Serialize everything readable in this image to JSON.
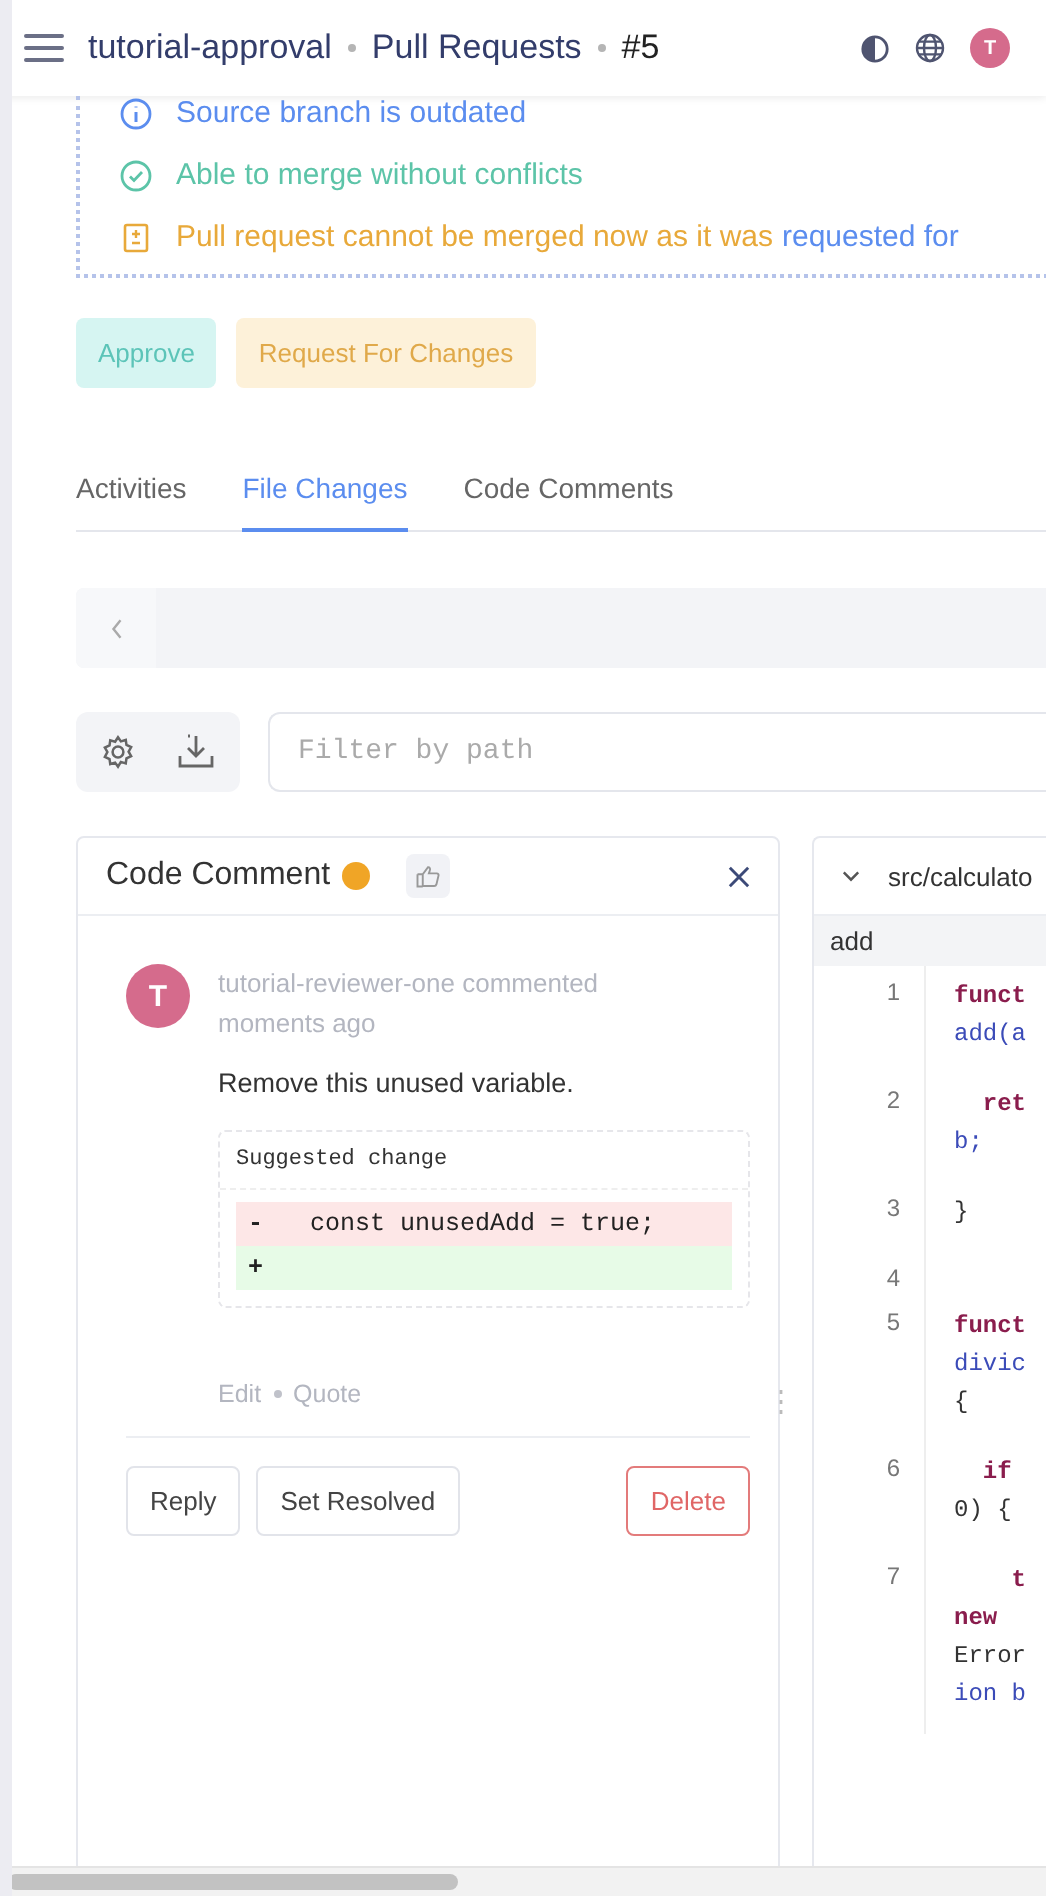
{
  "header": {
    "breadcrumbs": [
      "tutorial-approval",
      "Pull Requests",
      "#5"
    ],
    "avatar_initial": "T"
  },
  "merge_checks": [
    {
      "kind": "info",
      "text": "Source branch is outdated"
    },
    {
      "kind": "success",
      "text": "Able to merge without conflicts"
    },
    {
      "kind": "warning",
      "text": "Pull request cannot be merged now as it was",
      "link": "requested for"
    }
  ],
  "review_buttons": [
    {
      "kind": "approve",
      "label": "Approve"
    },
    {
      "kind": "changes",
      "label": "Request For Changes"
    }
  ],
  "tabs": [
    {
      "label": "Activities",
      "selected": false
    },
    {
      "label": "File Changes",
      "selected": true
    },
    {
      "label": "Code Comments",
      "selected": false
    }
  ],
  "filter": {
    "placeholder": "Filter by path"
  },
  "comment_panel": {
    "title": "Code Comment",
    "author_initial": "T",
    "meta": "tutorial-reviewer-one commented moments ago",
    "body": "Remove this unused variable.",
    "suggestion": {
      "title": "Suggested change",
      "lines": [
        {
          "kind": "removed",
          "sign": "-",
          "code": "  const unusedAdd = true;"
        },
        {
          "kind": "added",
          "sign": "+"
        }
      ]
    },
    "links": [
      "Edit",
      "Quote"
    ],
    "buttons": [
      {
        "kind": "default",
        "label": "Reply"
      },
      {
        "kind": "default",
        "label": "Set Resolved"
      },
      {
        "kind": "danger",
        "label": "Delete"
      }
    ]
  },
  "code_panel": {
    "file": "src/calculato",
    "section": "add",
    "lines": [
      {
        "number": "1",
        "segments": [
          {
            "kind": "keyword",
            "text": "funct"
          },
          {
            "kind": "ident",
            "text": "add(a"
          }
        ]
      },
      {
        "number": "2",
        "segments": [
          {
            "kind": "keyword",
            "text": "  ret"
          },
          {
            "kind": "ident",
            "text": "b;"
          }
        ]
      },
      {
        "number": "3",
        "segments": [
          {
            "kind": "plain",
            "text": "}"
          }
        ]
      },
      {
        "number": "4"
      },
      {
        "number": "5",
        "segments": [
          {
            "kind": "keyword",
            "text": "funct"
          },
          {
            "kind": "ident",
            "text": "divic"
          },
          {
            "kind": "plain",
            "text": "{"
          }
        ]
      },
      {
        "number": "6",
        "segments": [
          {
            "kind": "keyword",
            "text": "  if"
          },
          {
            "kind": "plain",
            "text": "0) {"
          }
        ]
      },
      {
        "number": "7",
        "segments": [
          {
            "kind": "keyword",
            "text": "    t"
          },
          {
            "kind": "keyword",
            "text": "new"
          },
          {
            "kind": "plain",
            "text": "Error"
          },
          {
            "kind": "ident",
            "text": "ion b"
          }
        ]
      }
    ]
  }
}
